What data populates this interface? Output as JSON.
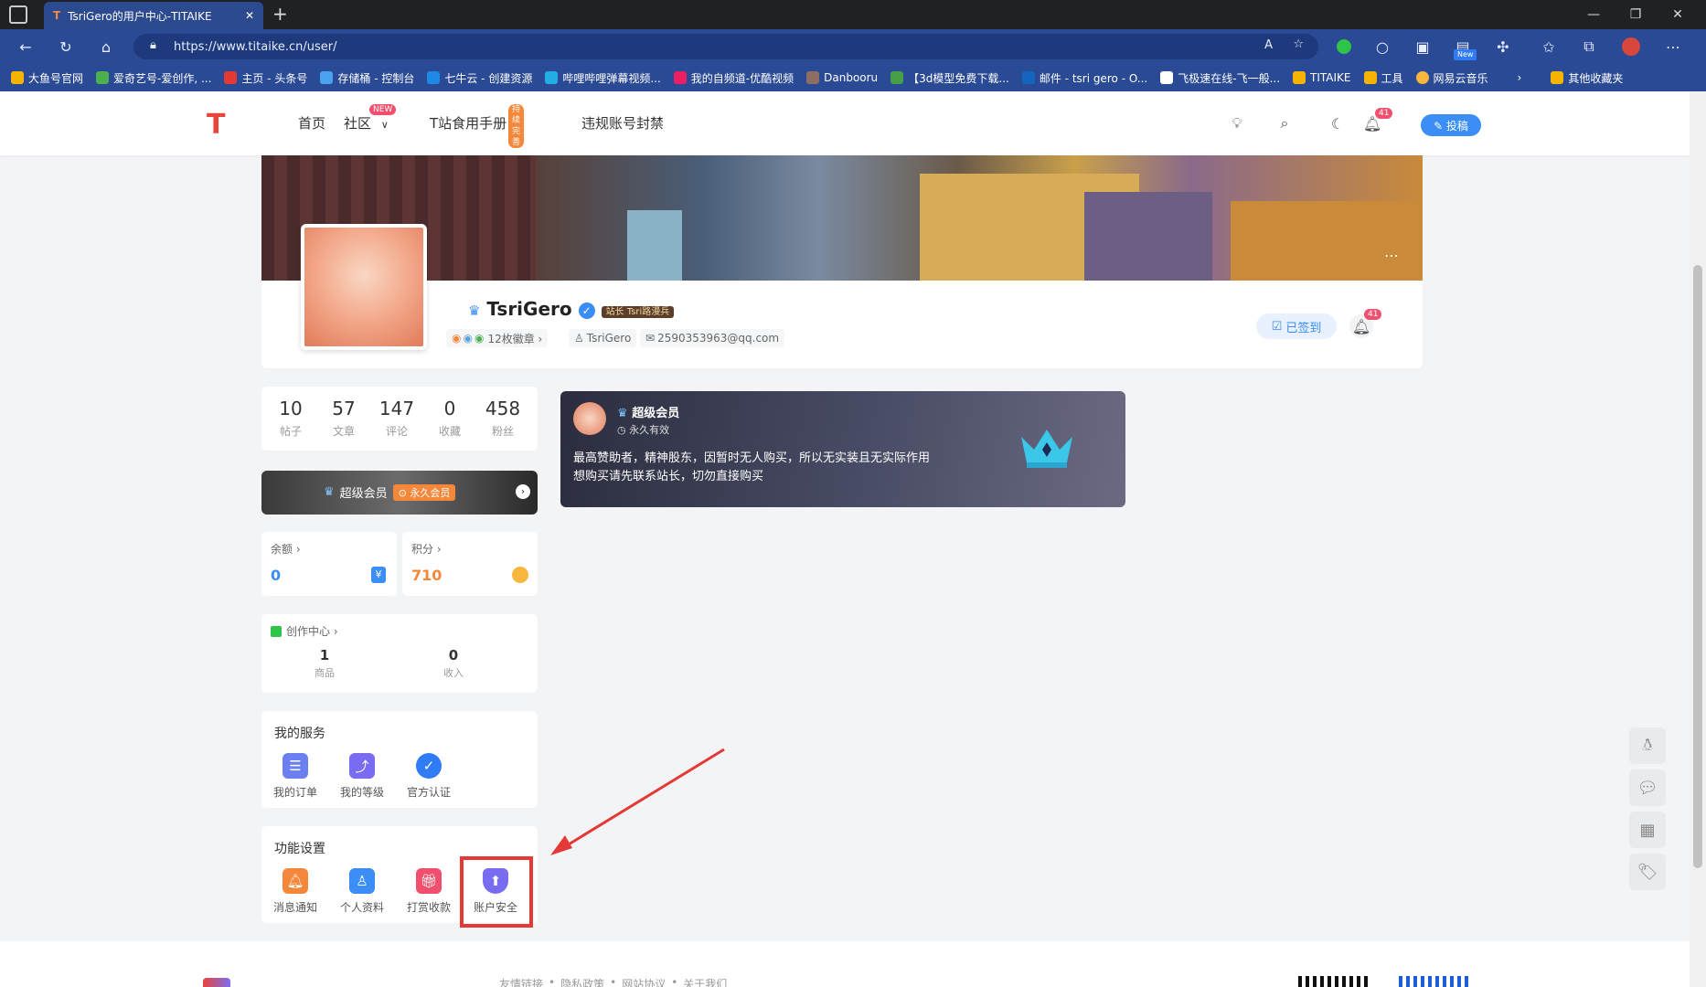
{
  "browser": {
    "tab_title": "TsriGero的用户中心-TITAIKE",
    "url": "https://www.titaike.cn/user/",
    "new_tab_symbol": "+",
    "extension_new_badge": "New",
    "bookmarks": [
      "大鱼号官网",
      "爱奇艺号-爱创作, ...",
      "主页 - 头条号",
      "存储桶 - 控制台",
      "七牛云 - 创建资源",
      "哔哩哔哩弹幕视频...",
      "我的自频道-优酷视频",
      "Danbooru",
      "【3d模型免费下载...",
      "邮件 - tsri gero - O...",
      "飞极速在线-飞一般...",
      "TITAIKE",
      "工具",
      "网易云音乐"
    ],
    "other_bookmarks": "其他收藏夹"
  },
  "header": {
    "nav": [
      "首页",
      "社区",
      "T站食用手册",
      "违规账号封禁"
    ],
    "community_badge": "NEW",
    "manual_badge": "持续完善",
    "notification_count": "41",
    "post_button": "✎ 投稿"
  },
  "profile": {
    "username": "TsriGero",
    "role_badge": "站长 Tsri路漫兵",
    "medals": "12枚徽章 ›",
    "user_id": "TsriGero",
    "email": "2590353963@qq.com",
    "signed_button": "已签到",
    "bell_count": "41"
  },
  "stats": [
    {
      "value": "10",
      "label": "帖子"
    },
    {
      "value": "57",
      "label": "文章"
    },
    {
      "value": "147",
      "label": "评论"
    },
    {
      "value": "0",
      "label": "收藏"
    },
    {
      "value": "458",
      "label": "粉丝"
    }
  ],
  "vip_bar": {
    "label": "超级会员",
    "tag": "⊙ 永久会员"
  },
  "balance": {
    "label": "余额 ›",
    "value": "0"
  },
  "points": {
    "label": "积分 ›",
    "value": "710"
  },
  "creator": {
    "title": "创作中心 ›",
    "items": [
      {
        "value": "1",
        "label": "商品"
      },
      {
        "value": "0",
        "label": "收入"
      }
    ]
  },
  "services": {
    "title": "我的服务",
    "items": [
      {
        "label": "我的订单",
        "icon": "order-icon",
        "color": "#6b7ff0"
      },
      {
        "label": "我的等级",
        "icon": "level-icon",
        "color": "#7a6cf0"
      },
      {
        "label": "官方认证",
        "icon": "verified-icon",
        "color": "#2f7cf6"
      }
    ]
  },
  "settings": {
    "title": "功能设置",
    "items": [
      {
        "label": "消息通知",
        "icon": "bell-icon",
        "color": "#f5873a"
      },
      {
        "label": "个人资料",
        "icon": "profile-icon",
        "color": "#3a8ef6"
      },
      {
        "label": "打赏收款",
        "icon": "gift-icon",
        "color": "#f0506e"
      },
      {
        "label": "账户安全",
        "icon": "shield-icon",
        "color": "#7a6cf0"
      }
    ]
  },
  "vip_card": {
    "title": "超级会员",
    "validity": "永久有效",
    "line1": "最高赞助者，精神股东，因暂时无人购买，所以无实装且无实际作用",
    "line2": "想购买请先联系站长，切勿直接购买"
  },
  "footer": {
    "links": [
      "友情链接",
      "隐私政策",
      "网站协议",
      "关于我们"
    ]
  },
  "colors": {
    "accent": "#3a8ef6",
    "annotation": "#e53935",
    "points": "#f5873a"
  }
}
